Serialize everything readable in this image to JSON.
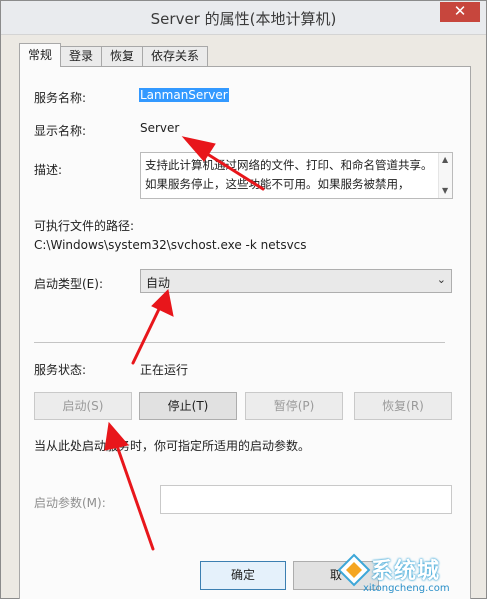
{
  "window": {
    "title": "Server 的属性(本地计算机)",
    "close_glyph": "✕"
  },
  "tabs": [
    {
      "label": "常规",
      "active": true
    },
    {
      "label": "登录",
      "active": false
    },
    {
      "label": "恢复",
      "active": false
    },
    {
      "label": "依存关系",
      "active": false
    }
  ],
  "general": {
    "service_name_label": "服务名称:",
    "service_name_value": "LanmanServer",
    "display_name_label": "显示名称:",
    "display_name_value": "Server",
    "description_label": "描述:",
    "description_text": "支持此计算机通过网络的文件、打印、和命名管道共享。如果服务停止，这些功能不可用。如果服务被禁用，",
    "path_label": "可执行文件的路径:",
    "path_value": "C:\\Windows\\system32\\svchost.exe -k netsvcs",
    "startup_type_label": "启动类型(E):",
    "startup_type_value": "自动",
    "status_label": "服务状态:",
    "status_value": "正在运行",
    "start_hint": "当从此处启动服务时，你可指定所适用的启动参数。",
    "start_params_label": "启动参数(M):",
    "start_params_value": ""
  },
  "buttons": {
    "start": "启动(S)",
    "stop": "停止(T)",
    "pause": "暂停(P)",
    "resume": "恢复(R)",
    "ok": "确定",
    "cancel": "取"
  },
  "watermark": {
    "text": "系统城",
    "url": "xitongcheng.com"
  },
  "colors": {
    "annotation_arrow": "#e8161b",
    "selection": "#3399ff",
    "close_button": "#c7463d"
  }
}
